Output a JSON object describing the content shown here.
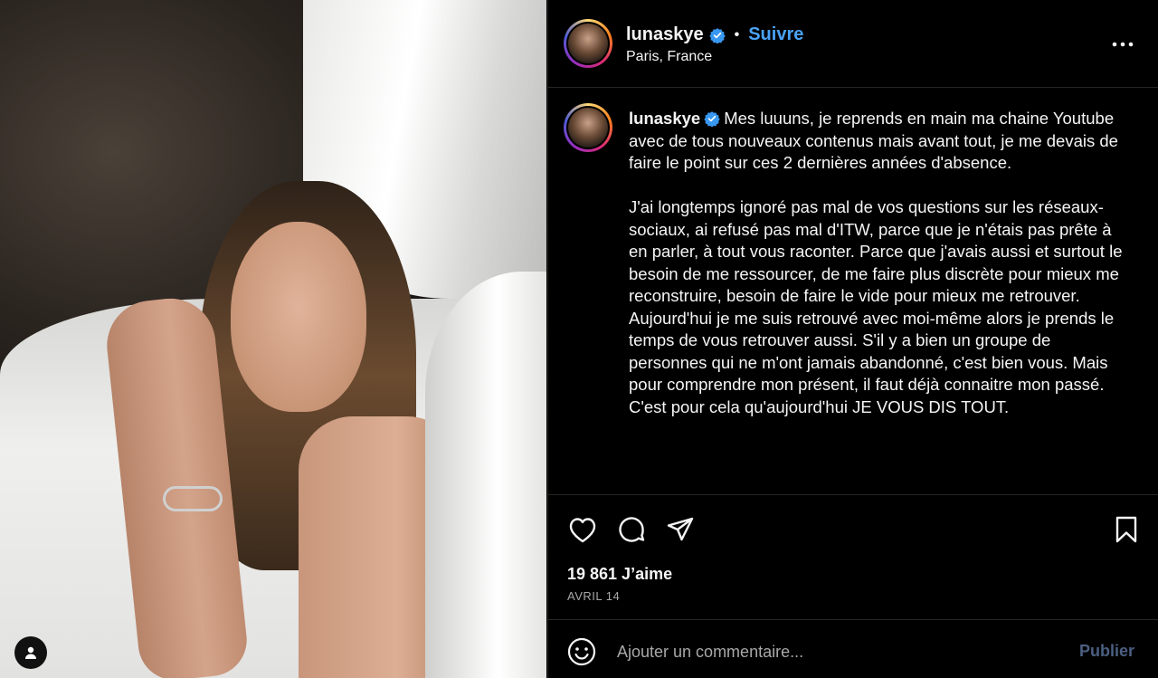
{
  "post": {
    "username": "lunaskye",
    "follow_label": "Suivre",
    "separator": "•",
    "location": "Paris, France",
    "caption": "Mes luuuns, je reprends en main ma chaine Youtube avec de tous nouveaux contenus mais avant tout, je me devais de faire le point sur ces 2 dernières années d'absence.\n\nJ'ai longtemps ignoré pas mal de vos questions sur les réseaux-sociaux, ai refusé pas mal d'ITW, parce que je n'étais pas prête à en parler, à tout vous raconter. Parce que j'avais aussi et surtout le besoin de me ressourcer, de me faire plus discrète pour mieux me reconstruire, besoin de faire le vide pour mieux me retrouver. Aujourd'hui je me suis retrouvé avec moi-même alors je prends le temps de vous retrouver aussi. S'il y a bien un groupe de personnes qui ne m'ont jamais abandonné, c'est bien vous. Mais pour comprendre mon présent, il faut déjà connaitre mon passé. C'est pour cela qu'aujourd'hui JE VOUS DIS TOUT.",
    "likes": "19 861 J’aime",
    "date": "AVRIL 14",
    "comment_placeholder": "Ajouter un commentaire...",
    "publish_label": "Publier"
  },
  "icons": {
    "verified": "verified-badge-icon",
    "more": "more-options-icon",
    "like": "heart-icon",
    "comment": "comment-icon",
    "share": "send-icon",
    "save": "bookmark-icon",
    "emoji": "emoji-icon",
    "user_tags": "user-icon"
  },
  "colors": {
    "accent": "#4aa3f6",
    "publish_disabled": "#4b5f82",
    "verified": "#3897f0"
  }
}
